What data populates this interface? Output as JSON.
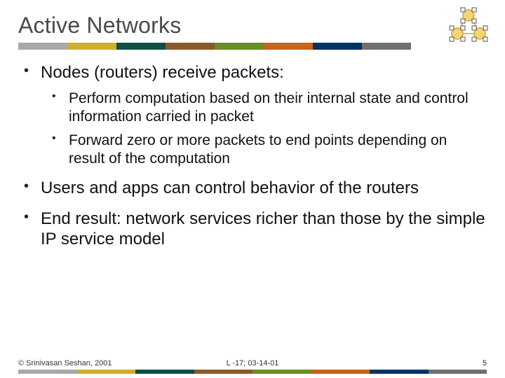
{
  "title": "Active Networks",
  "corner_icon": "network-cluster-icon",
  "bullets": {
    "b1": "Nodes (routers) receive packets:",
    "b1_sub": {
      "s1": "Perform computation based on their internal state and control information carried in packet",
      "s2": "Forward zero or more packets to end points depending on result of the computation"
    },
    "b2": "Users and apps can control behavior of the routers",
    "b3": "End result: network services richer than those by the simple IP service model"
  },
  "footer": {
    "copyright": "© Srinivasan Seshan, 2001",
    "center": "L -17; 03-14-01",
    "page": "5"
  },
  "bar_colors": [
    "#a9a9a9",
    "#cfae2c",
    "#0f4f44",
    "#8a5a2b",
    "#6b8e23",
    "#c86418",
    "#003366",
    "#707070"
  ]
}
